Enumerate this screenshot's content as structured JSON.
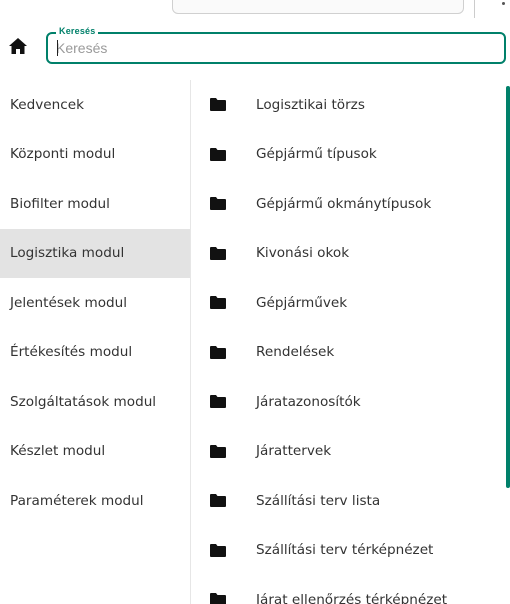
{
  "search": {
    "legend": "Keresés",
    "placeholder": "Keresés",
    "value": ""
  },
  "icons": {
    "home": "home-icon",
    "folder": "folder-icon"
  },
  "colors": {
    "accent": "#00806a",
    "active_background": "#e3e3e3",
    "text": "#333333"
  },
  "modules": [
    {
      "label": "Kedvencek",
      "active": false
    },
    {
      "label": "Központi modul",
      "active": false
    },
    {
      "label": "Biofilter modul",
      "active": false
    },
    {
      "label": "Logisztika modul",
      "active": true
    },
    {
      "label": "Jelentések modul",
      "active": false
    },
    {
      "label": "Értékesítés modul",
      "active": false
    },
    {
      "label": "Szolgáltatások modul",
      "active": false
    },
    {
      "label": "Készlet modul",
      "active": false
    },
    {
      "label": "Paraméterek modul",
      "active": false
    }
  ],
  "folders": [
    {
      "label": "Logisztikai törzs"
    },
    {
      "label": "Gépjármű típusok"
    },
    {
      "label": "Gépjármű okmánytípusok"
    },
    {
      "label": "Kivonási okok"
    },
    {
      "label": "Gépjárművek"
    },
    {
      "label": "Rendelések"
    },
    {
      "label": "Járatazonosítók"
    },
    {
      "label": "Járattervek"
    },
    {
      "label": "Szállítási terv lista"
    },
    {
      "label": "Szállítási terv térképnézet"
    },
    {
      "label": "Járat ellenőrzés térképnézet"
    }
  ]
}
